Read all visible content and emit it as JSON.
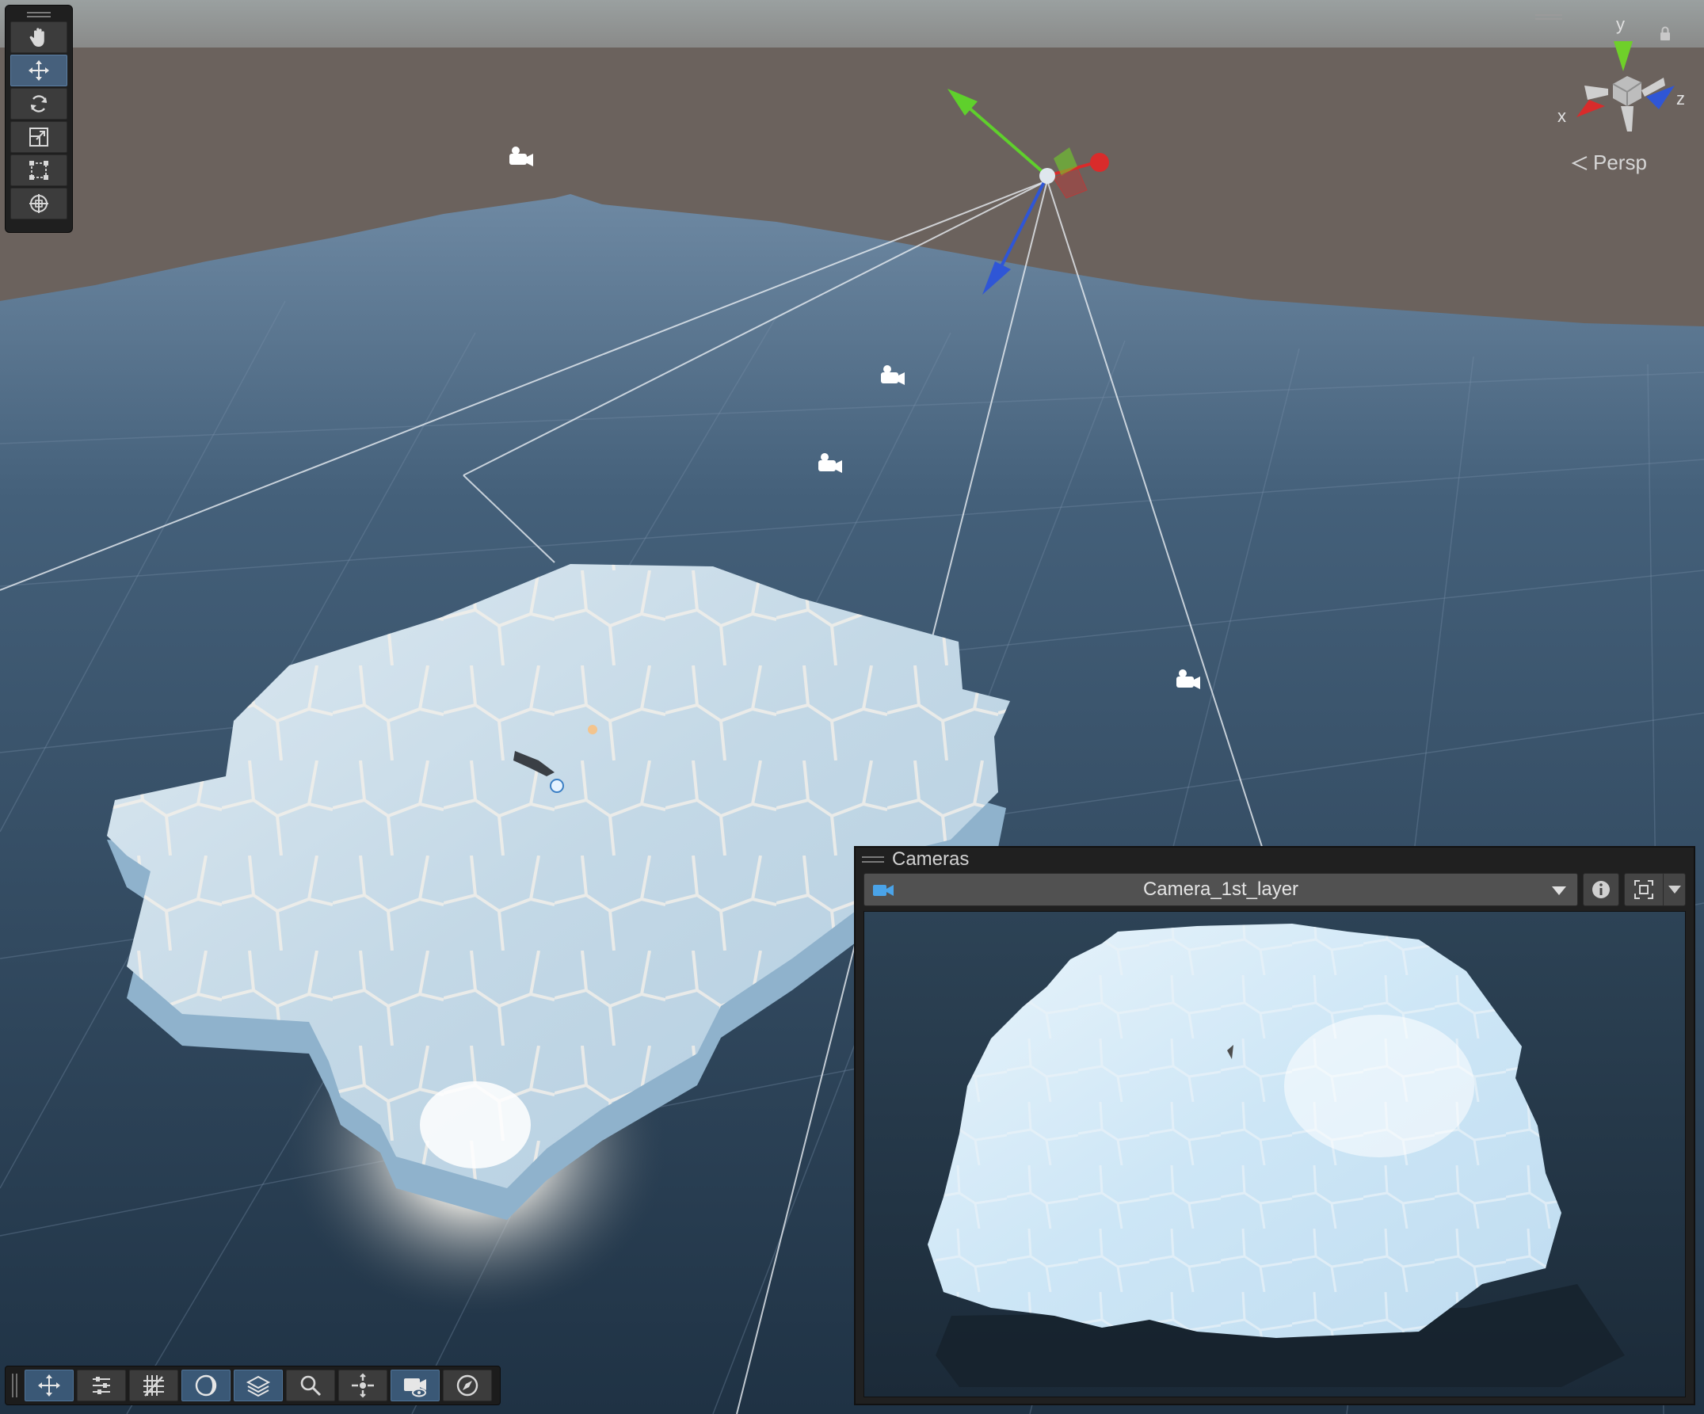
{
  "scene": {
    "projection_label": "Persp",
    "axis_labels": {
      "x": "x",
      "y": "y",
      "z": "z"
    }
  },
  "tool_palette": {
    "tools": [
      {
        "name": "hand-tool",
        "icon": "hand-icon",
        "active": false
      },
      {
        "name": "move-tool",
        "icon": "move-icon",
        "active": true
      },
      {
        "name": "rotate-tool",
        "icon": "rotate-icon",
        "active": false
      },
      {
        "name": "scale-tool",
        "icon": "scale-icon",
        "active": false
      },
      {
        "name": "rect-tool",
        "icon": "rect-transform-icon",
        "active": false
      },
      {
        "name": "transform-tool",
        "icon": "transform-icon",
        "active": false
      }
    ]
  },
  "overlay_toolbar": {
    "buttons": [
      "move-icon",
      "settings-sliders-icon",
      "grid-icon",
      "shading-icon",
      "layers-icon",
      "search-icon",
      "center-icon",
      "camera-eye-icon",
      "compass-icon"
    ]
  },
  "cameras_panel": {
    "title": "Cameras",
    "selected_camera": "Camera_1st_layer"
  },
  "colors": {
    "accent": "#46607c",
    "axis_x": "#d92b2b",
    "axis_y": "#6fcf2a",
    "axis_z": "#2f56d6"
  }
}
